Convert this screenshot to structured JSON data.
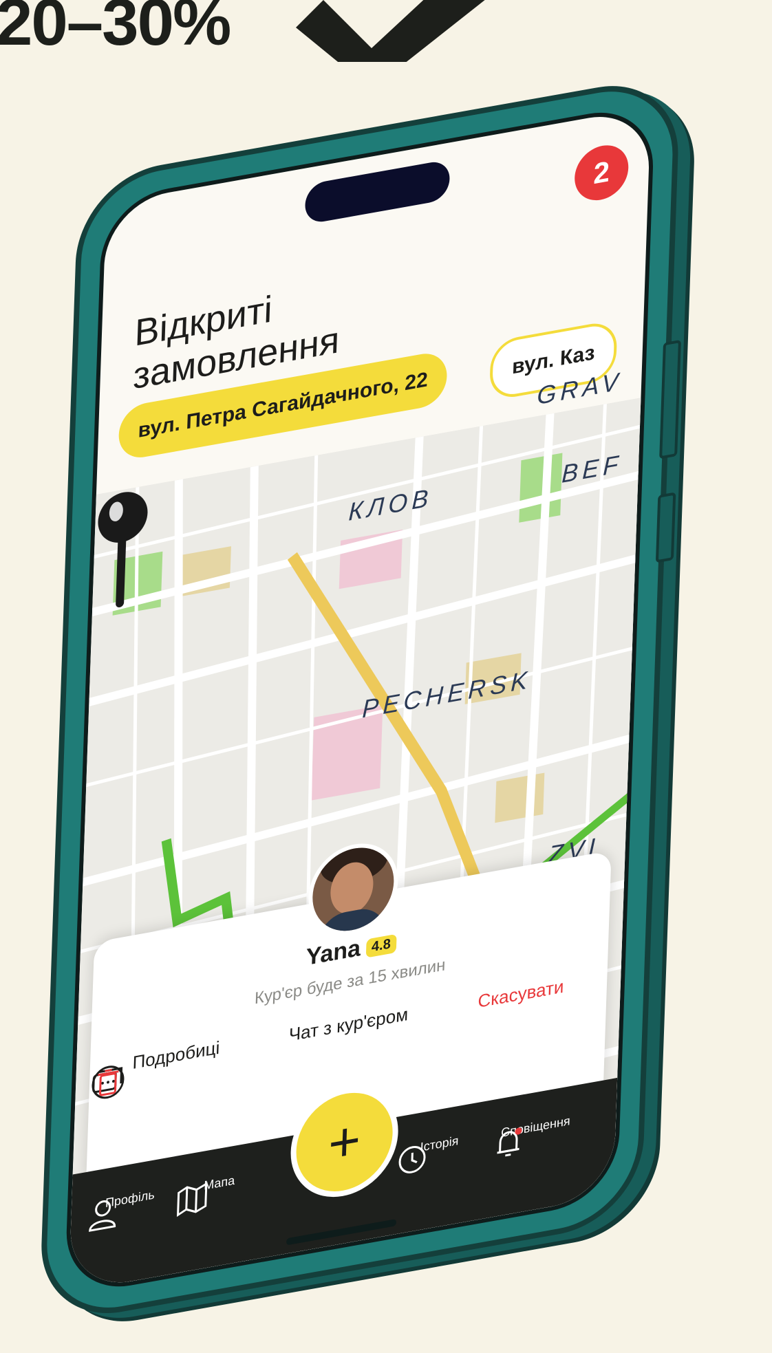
{
  "headline": "20–30%",
  "app": {
    "notification_count": "2",
    "title": "Відкриті замовлення",
    "address_chips": [
      {
        "label": "вул. Петра Сагайдачного, 22",
        "active": true
      },
      {
        "label": "вул. Каз",
        "active": false
      }
    ],
    "map_labels": [
      "GRAV",
      "КЛОВ",
      "BEF",
      "PECHERSK",
      "ZVI"
    ],
    "courier": {
      "name": "Yana",
      "rating": "4.8",
      "eta_text": "Кур'єр буде за 15 хвилин"
    },
    "actions": {
      "details": "Подробиці",
      "chat": "Чат з кур'єром",
      "cancel": "Скасувати"
    },
    "nav": {
      "profile": "Профіль",
      "map": "Мапа",
      "history": "Історія",
      "notifications": "Сповіщення"
    }
  },
  "colors": {
    "accent_yellow": "#f4dc3b",
    "phone_teal": "#1f7c77",
    "route_green": "#5cc23a",
    "alert_red": "#e8383a",
    "nav_dark": "#1e201d"
  }
}
